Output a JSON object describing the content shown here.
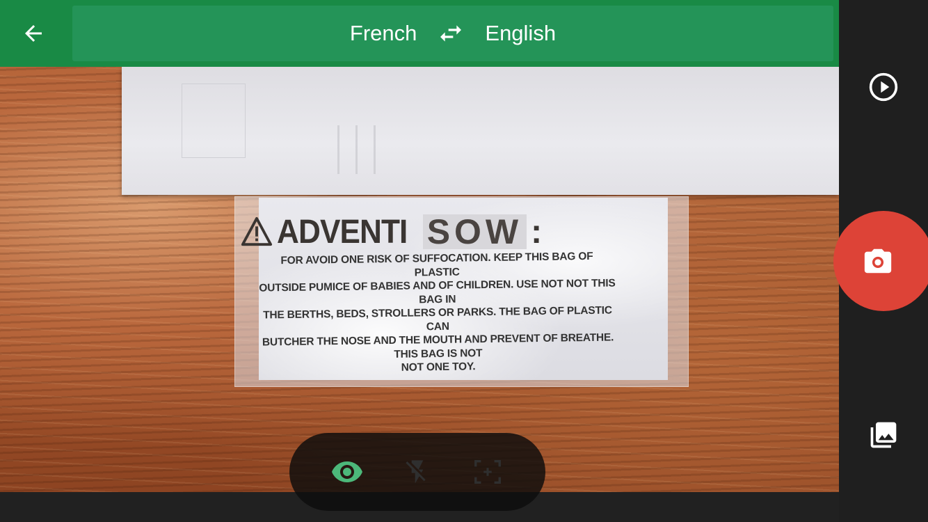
{
  "header": {
    "source_language": "French",
    "target_language": "English",
    "back_icon": "arrow-left-icon",
    "swap_icon": "swap-horizontal-icon"
  },
  "camera_view": {
    "warning_title_prefix": "ADVENTI",
    "warning_title_suffix": "SOW",
    "warning_title_colon": ":",
    "warning_text_lines": [
      "FOR AVOID ONE RISK OF SUFFOCATION. KEEP THIS BAG OF PLASTIC",
      "OUTSIDE PUMICE OF BABIES AND OF CHILDREN. USE NOT NOT THIS BAG IN",
      "THE BERTHS, BEDS, STROLLERS OR PARKS. THE BAG OF PLASTIC CAN",
      "BUTCHER THE NOSE AND THE MOUTH AND PREVENT OF BREATHE. THIS BAG IS NOT",
      "NOT ONE TOY."
    ]
  },
  "right_rail": {
    "play_icon": "play-circle-icon",
    "shutter_icon": "camera-icon",
    "gallery_icon": "photo-gallery-icon",
    "shutter_color": "#dd4337"
  },
  "bottom_controls": {
    "instant_icon": "eye-icon",
    "flash_icon": "flash-off-icon",
    "scan_icon": "scan-frame-icon",
    "active_color": "#4cb87a"
  },
  "colors": {
    "header_green": "#198a45",
    "lang_box_green": "#249458"
  }
}
